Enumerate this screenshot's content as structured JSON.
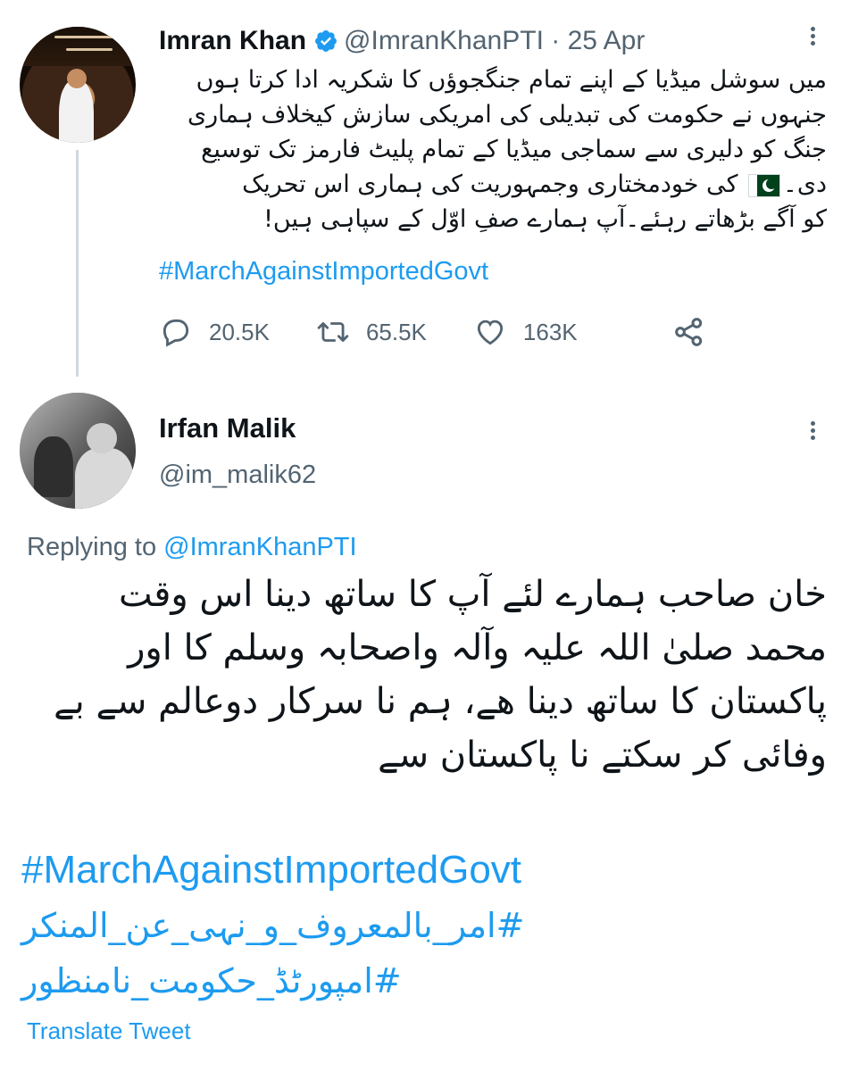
{
  "parent_tweet": {
    "display_name": "Imran Khan",
    "handle": "@ImranKhanPTI",
    "separator": " · ",
    "date": "25 Apr",
    "verified_icon": "verified-badge-icon",
    "body_lines": [
      "میں سوشل میڈیا کے اپنے تمام جنگجوؤں کا شکریہ ادا کرتا ہوں",
      "جنہوں نے حکومت کی تبدیلی کی امریکی سازش کیخلاف ہماری",
      "جنگ کو دلیری سے سماجی میڈیا کے تمام پلیٹ فارمز تک توسیع",
      "کی خودمختاری وجمہوریت کی ہماری اس تحریک",
      "کو آگے بڑھاتے رہئے۔آپ ہمارے صفِ اوّل کے سپاہی ہیں!"
    ],
    "line4_prefix": "دی۔",
    "hashtag": "#MarchAgainstImportedGovt",
    "counts": {
      "replies": "20.5K",
      "retweets": "65.5K",
      "likes": "163K"
    }
  },
  "reply_tweet": {
    "display_name": "Irfan Malik",
    "handle": "@im_malik62",
    "replying_prefix": "Replying to ",
    "replying_to": "@ImranKhanPTI",
    "body_lines": [
      "خان صاحب ہمارے لئے آپ کا ساتھ دینا اس وقت",
      "محمد صلیٰ اللہ علیہ وآلہ واصحابہ وسلم کا اور",
      "پاکستان کا ساتھ دینا ھے، ہم نا سرکار دوعالم سے بے",
      "وفائی کر سکتے نا پاکستان سے"
    ],
    "hashtags": [
      "#MarchAgainstImportedGovt",
      "#امر_بالمعروف_و_نہی_عن_المنکر",
      "#امپورٹڈ_حکومت_نامنظور"
    ],
    "translate_label": "Translate Tweet"
  },
  "colors": {
    "accent": "#1d9bf0",
    "secondary_text": "#536471",
    "primary_text": "#0f1419",
    "thread_line": "#cfd9de"
  }
}
